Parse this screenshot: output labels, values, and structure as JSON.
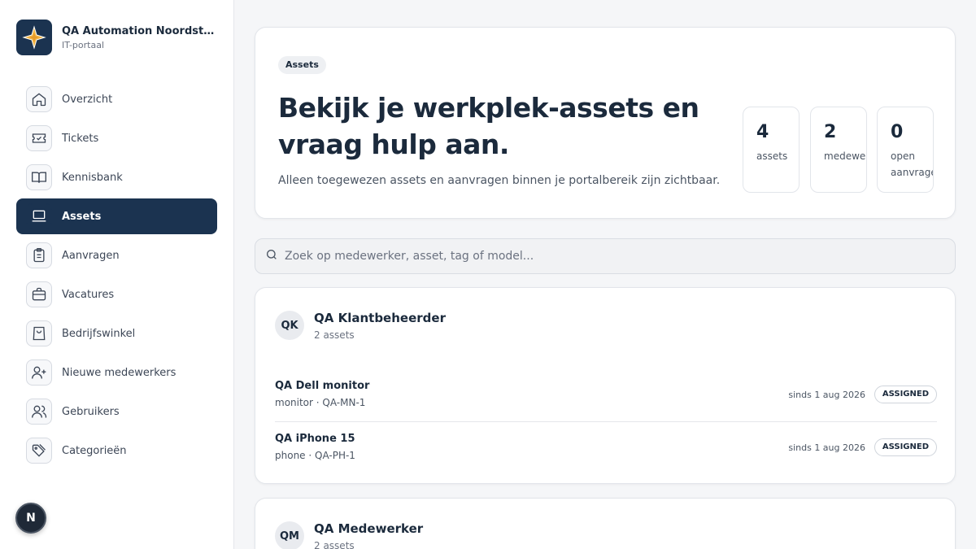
{
  "brand": {
    "title": "QA Automation Noordster T...",
    "subtitle": "IT-portaal",
    "logo_icon": "compass-star-icon",
    "accent": "#f2b544"
  },
  "sidebar": {
    "items": [
      {
        "label": "Overzicht",
        "icon": "home-icon",
        "active": false
      },
      {
        "label": "Tickets",
        "icon": "ticket-check-icon",
        "active": false
      },
      {
        "label": "Kennisbank",
        "icon": "book-icon",
        "active": false
      },
      {
        "label": "Assets",
        "icon": "laptop-icon",
        "active": true
      },
      {
        "label": "Aanvragen",
        "icon": "clipboard-list-icon",
        "active": false
      },
      {
        "label": "Vacatures",
        "icon": "briefcase-icon",
        "active": false
      },
      {
        "label": "Bedrijfswinkel",
        "icon": "shopping-bag-icon",
        "active": false
      },
      {
        "label": "Nieuwe medewerkers",
        "icon": "user-plus-icon",
        "active": false
      },
      {
        "label": "Gebruikers",
        "icon": "users-icon",
        "active": false
      },
      {
        "label": "Categorieën",
        "icon": "tags-icon",
        "active": false
      }
    ],
    "user_initial": "N"
  },
  "hero": {
    "badge": "Assets",
    "title": "Bekijk je werkplek-assets en vraag hulp aan.",
    "description": "Alleen toegewezen assets en aanvragen binnen je portalbereik zijn zichtbaar.",
    "stats": [
      {
        "value": "4",
        "label": "assets"
      },
      {
        "value": "2",
        "label": "medewerkers"
      },
      {
        "value": "0",
        "label": "open\naanvragen"
      }
    ]
  },
  "search": {
    "placeholder": "Zoek op medewerker, asset, tag of model..."
  },
  "groups": [
    {
      "initials": "QK",
      "name": "QA Klantbeheerder",
      "count": "2 assets",
      "assets": [
        {
          "name": "QA Dell monitor",
          "meta": "monitor · QA-MN-1",
          "since": "sinds 1 aug 2026",
          "status": "ASSIGNED"
        },
        {
          "name": "QA iPhone 15",
          "meta": "phone · QA-PH-1",
          "since": "sinds 1 aug 2026",
          "status": "ASSIGNED"
        }
      ]
    },
    {
      "initials": "QM",
      "name": "QA Medewerker",
      "count": "2 assets",
      "assets": []
    }
  ],
  "colors": {
    "primary": "#1b3350",
    "background": "#f5f6f8"
  }
}
